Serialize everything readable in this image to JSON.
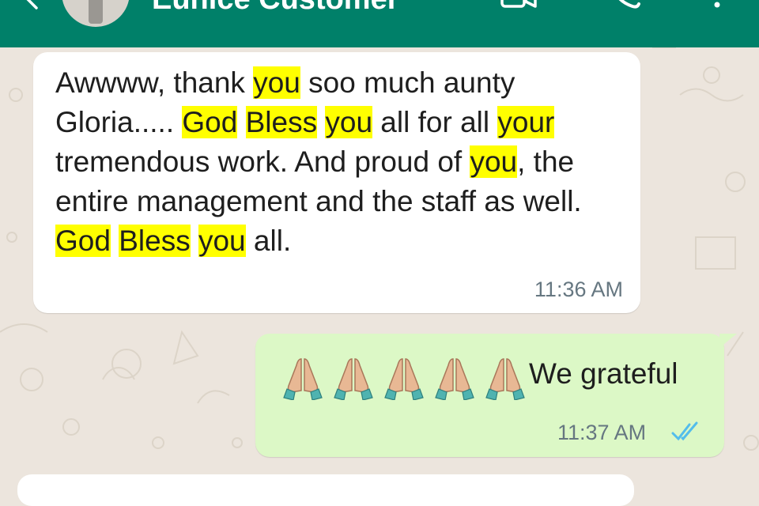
{
  "header": {
    "contact_name": "Eunice Customer",
    "accent_color": "#008069",
    "icons": [
      "back-arrow-icon",
      "avatar",
      "video-call-icon",
      "phone-call-icon",
      "more-menu-icon"
    ]
  },
  "messages": [
    {
      "direction": "incoming",
      "segments": [
        {
          "t": "Awwww, thank "
        },
        {
          "t": "you",
          "hl": true
        },
        {
          "t": " soo much aunty Gloria..... "
        },
        {
          "t": "God",
          "hl": true
        },
        {
          "t": " "
        },
        {
          "t": "Bless",
          "hl": true
        },
        {
          "t": " "
        },
        {
          "t": "you",
          "hl": true
        },
        {
          "t": " all for all "
        },
        {
          "t": "your",
          "hl": true
        },
        {
          "t": " tremendous work. And proud of "
        },
        {
          "t": "you",
          "hl": true
        },
        {
          "t": ", the entire management and the staff as well. "
        },
        {
          "t": "God",
          "hl": true
        },
        {
          "t": " "
        },
        {
          "t": "Bless",
          "hl": true
        },
        {
          "t": " "
        },
        {
          "t": "you",
          "hl": true
        },
        {
          "t": " all."
        }
      ],
      "time": "11:36 AM"
    },
    {
      "direction": "outgoing",
      "emoji": "folded-hands-icon",
      "emoji_count": 5,
      "text": "We grateful",
      "time": "11:37 AM",
      "status": "read-ticks-icon",
      "status_color": "#53bdeb"
    }
  ],
  "colors": {
    "chat_background": "#ece5dd",
    "incoming_bubble": "#ffffff",
    "outgoing_bubble": "#dcf8c6",
    "highlight": "#ffff00"
  }
}
